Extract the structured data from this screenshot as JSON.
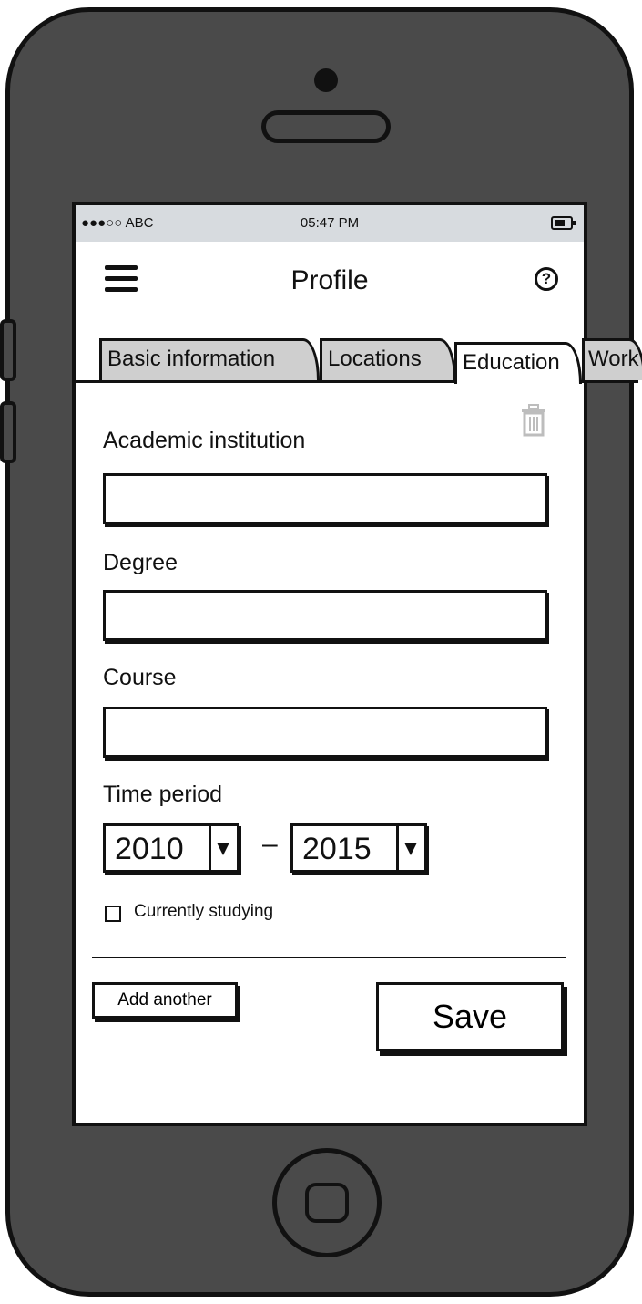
{
  "status_bar": {
    "signal": "●●●○○ ABC",
    "time": "05:47 PM",
    "battery_icon": "battery-icon"
  },
  "header": {
    "menu_icon": "hamburger-menu-icon",
    "title": "Profile",
    "help_icon": "help-circle-icon",
    "help_glyph": "?"
  },
  "tabs": [
    {
      "label": "Basic information",
      "active": false
    },
    {
      "label": "Locations",
      "active": false
    },
    {
      "label": "Education",
      "active": true
    },
    {
      "label": "Work",
      "active": false
    }
  ],
  "form": {
    "delete_icon": "trash-icon",
    "institution_label": "Academic institution",
    "institution_value": "",
    "degree_label": "Degree",
    "degree_value": "",
    "course_label": "Course",
    "course_value": "",
    "time_period_label": "Time period",
    "start_year": "2010",
    "separator": "–",
    "end_year": "2015",
    "currently_studying_label": "Currently studying",
    "currently_studying_checked": false
  },
  "actions": {
    "add_another_label": "Add another",
    "save_label": "Save"
  },
  "colors": {
    "phone_body": "#4a4a4a",
    "status_bar": "#d7dbdf",
    "inactive_tab": "#cfcfcf",
    "outline": "#111111"
  }
}
